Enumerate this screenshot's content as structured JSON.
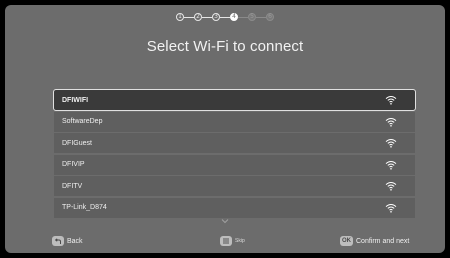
{
  "stepper": {
    "steps": [
      "1",
      "2",
      "3",
      "4",
      "5",
      "6"
    ],
    "current": 4
  },
  "title": "Select Wi-Fi to connect",
  "networks": [
    {
      "ssid": "DFIWIFI",
      "selected": true
    },
    {
      "ssid": "SoftwareDep",
      "selected": false
    },
    {
      "ssid": "DFIGuest",
      "selected": false
    },
    {
      "ssid": "DFIVIP",
      "selected": false
    },
    {
      "ssid": "DFITV",
      "selected": false
    },
    {
      "ssid": "TP-Link_D874",
      "selected": false
    }
  ],
  "footer": {
    "back_label": "Back",
    "skip_label": "Skip",
    "ok_key": "OK",
    "confirm_label": "Confirm and next"
  },
  "colors": {
    "background": "#6c6c6c",
    "row": "#5f5f5f",
    "selected_row": "#3a3a3a"
  }
}
